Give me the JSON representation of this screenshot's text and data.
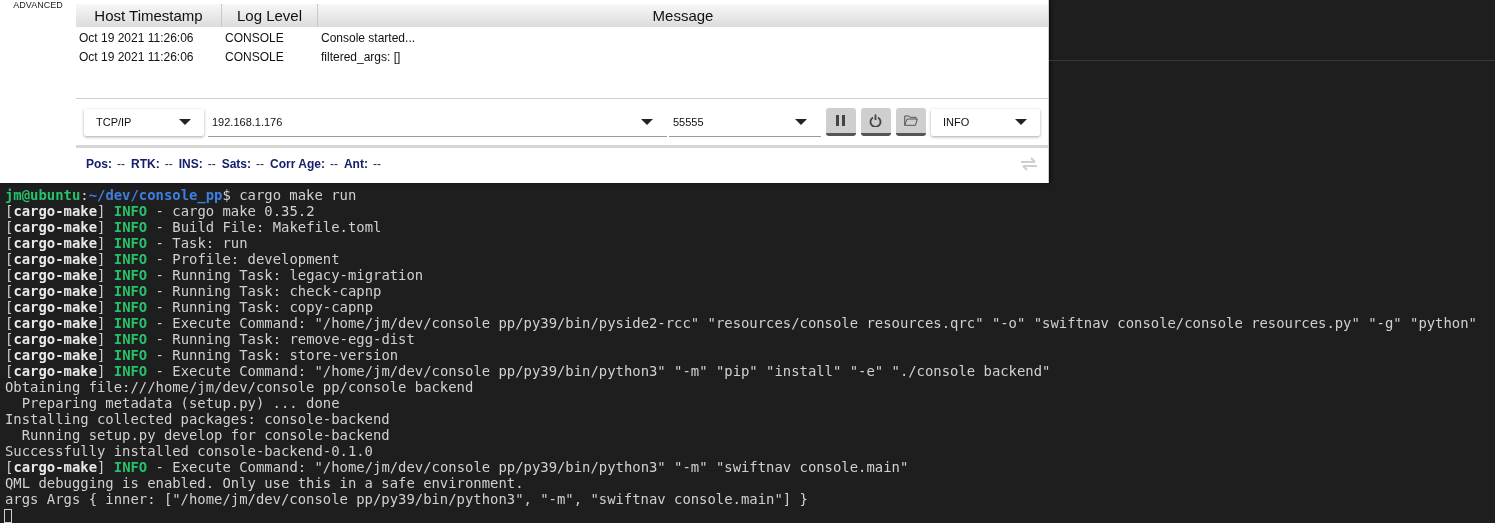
{
  "sidebar": {
    "label": "ADVANCED"
  },
  "log_table": {
    "columns": [
      "Host Timestamp",
      "Log Level",
      "Message"
    ],
    "rows": [
      {
        "host_timestamp": "Oct 19 2021 11:26:06",
        "log_level": "CONSOLE",
        "message": "Console started..."
      },
      {
        "host_timestamp": "Oct 19 2021 11:26:06",
        "log_level": "CONSOLE",
        "message": "filtered_args: []"
      }
    ]
  },
  "connection": {
    "type_dropdown": {
      "value": "TCP/IP"
    },
    "host": {
      "value": "192.168.1.176"
    },
    "port": {
      "value": "55555"
    },
    "buttons": [
      {
        "kind": "pause"
      },
      {
        "kind": "power"
      },
      {
        "kind": "folder"
      }
    ],
    "log_level_dropdown": {
      "value": "INFO"
    }
  },
  "status_bar": {
    "items": [
      {
        "label": "Pos:",
        "value": "--"
      },
      {
        "label": "RTK:",
        "value": "--"
      },
      {
        "label": "INS:",
        "value": "--"
      },
      {
        "label": "Sats:",
        "value": "--"
      },
      {
        "label": "Corr Age:",
        "value": "--"
      },
      {
        "label": "Ant:",
        "value": "--"
      }
    ]
  },
  "terminal": {
    "lines": [
      {
        "kind": "prompt",
        "user": "jm@ubuntu",
        "separator": ":",
        "path": "~/dev/console_pp",
        "command": "$ cargo make run"
      },
      {
        "kind": "log",
        "tag": "[**cargo-make**]",
        "level": "INFO",
        "message": "- cargo make 0.35.2"
      },
      {
        "kind": "log",
        "tag": "[**cargo-make**]",
        "level": "INFO",
        "message": "- Build File: Makefile.toml"
      },
      {
        "kind": "log",
        "tag": "[**cargo-make**]",
        "level": "INFO",
        "message": "- Task: run"
      },
      {
        "kind": "log",
        "tag": "[**cargo-make**]",
        "level": "INFO",
        "message": "- Profile: development"
      },
      {
        "kind": "log",
        "tag": "[**cargo-make**]",
        "level": "INFO",
        "message": "- Running Task: legacy-migration"
      },
      {
        "kind": "log",
        "tag": "[**cargo-make**]",
        "level": "INFO",
        "message": "- Running Task: check-capnp"
      },
      {
        "kind": "log",
        "tag": "[**cargo-make**]",
        "level": "INFO",
        "message": "- Running Task: copy-capnp"
      },
      {
        "kind": "log",
        "tag": "[**cargo-make**]",
        "level": "INFO",
        "message": "- Execute Command: \"/home/jm/dev/console pp/py39/bin/pyside2-rcc\" \"resources/console resources.qrc\" \"-o\" \"swiftnav console/console resources.py\" \"-g\" \"python\""
      },
      {
        "kind": "log",
        "tag": "[**cargo-make**]",
        "level": "INFO",
        "message": "- Running Task: remove-egg-dist"
      },
      {
        "kind": "log",
        "tag": "[**cargo-make**]",
        "level": "INFO",
        "message": "- Running Task: store-version"
      },
      {
        "kind": "log",
        "tag": "[**cargo-make**]",
        "level": "INFO",
        "message": "- Execute Command: \"/home/jm/dev/console pp/py39/bin/python3\" \"-m\" \"pip\" \"install\" \"-e\" \"./console backend\""
      },
      {
        "kind": "plain",
        "text": "Obtaining file:///home/jm/dev/console pp/console backend"
      },
      {
        "kind": "plain",
        "text": "  Preparing metadata (setup.py) ... done"
      },
      {
        "kind": "plain",
        "text": "Installing collected packages: console-backend"
      },
      {
        "kind": "plain",
        "text": "  Running setup.py develop for console-backend"
      },
      {
        "kind": "plain",
        "text": "Successfully installed console-backend-0.1.0"
      },
      {
        "kind": "log",
        "tag": "[**cargo-make**]",
        "level": "INFO",
        "message": "- Execute Command: \"/home/jm/dev/console pp/py39/bin/python3\" \"-m\" \"swiftnav console.main\""
      },
      {
        "kind": "plain",
        "text": "QML debugging is enabled. Only use this in a safe environment."
      },
      {
        "kind": "plain",
        "text": "args Args { inner: [\"/home/jm/dev/console pp/py39/bin/python3\", \"-m\", \"swiftnav console.main\"] }"
      },
      {
        "kind": "cursor"
      }
    ]
  }
}
